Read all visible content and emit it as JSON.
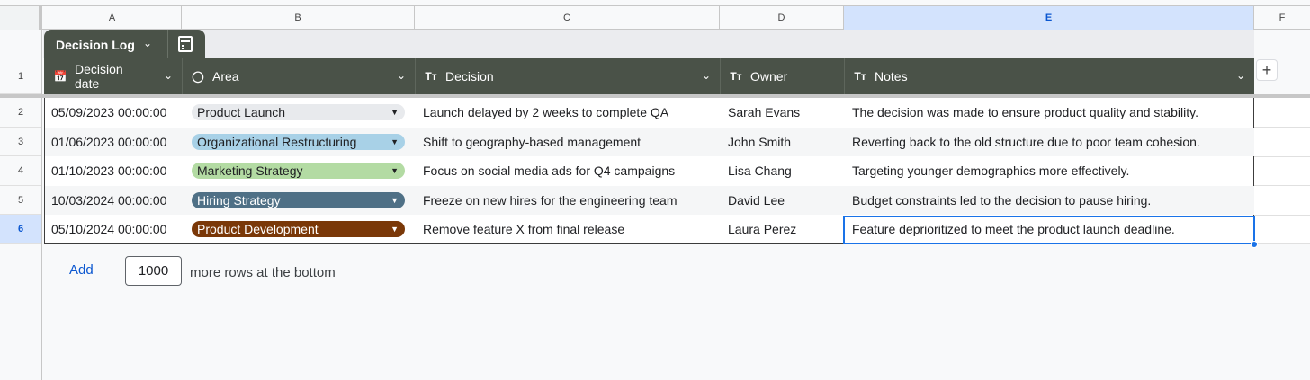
{
  "columns": [
    "A",
    "B",
    "C",
    "D",
    "E",
    "F"
  ],
  "selected_column": "E",
  "row_numbers": [
    "1",
    "2",
    "3",
    "4",
    "5",
    "6"
  ],
  "selected_row": "6",
  "table": {
    "name": "Decision Log",
    "headers": [
      {
        "label": "Decision date",
        "icon": "calendar-icon"
      },
      {
        "label": "Area",
        "icon": "dropdown-chip-icon"
      },
      {
        "label": "Decision",
        "icon": "text-type-icon",
        "icon_glyph": "Tт"
      },
      {
        "label": "Owner",
        "icon": "text-type-icon",
        "icon_glyph": "Tт"
      },
      {
        "label": "Notes",
        "icon": "text-type-icon",
        "icon_glyph": "Tт"
      }
    ],
    "rows": [
      {
        "date": "05/09/2023 00:00:00",
        "area": "Product Launch",
        "area_color": "#e8eaed",
        "area_text_color": "#202124",
        "decision": "Launch delayed by 2 weeks to complete QA",
        "owner": "Sarah Evans",
        "notes": "The decision was made to ensure product quality and stability."
      },
      {
        "date": "01/06/2023 00:00:00",
        "area": "Organizational Restructuring",
        "area_color": "#a8d1e7",
        "area_text_color": "#202124",
        "decision": "Shift to geography-based management",
        "owner": "John Smith",
        "notes": "Reverting back to the old structure due to poor team cohesion."
      },
      {
        "date": "01/10/2023 00:00:00",
        "area": "Marketing Strategy",
        "area_color": "#b3dba3",
        "area_text_color": "#202124",
        "decision": "Focus on social media ads for Q4 campaigns",
        "owner": "Lisa Chang",
        "notes": "Targeting younger demographics more effectively."
      },
      {
        "date": "10/03/2024 00:00:00",
        "area": "Hiring Strategy",
        "area_color": "#4f7086",
        "area_text_color": "#ffffff",
        "decision": "Freeze on new hires for the engineering team",
        "owner": "David Lee",
        "notes": "Budget constraints led to the decision to pause hiring."
      },
      {
        "date": "05/10/2024 00:00:00",
        "area": "Product Development",
        "area_color": "#7a3808",
        "area_text_color": "#ffffff",
        "decision": "Remove feature X from final release",
        "owner": "Laura Perez",
        "notes": "Feature deprioritized to meet the product launch deadline."
      }
    ]
  },
  "footer": {
    "add_label": "Add",
    "row_count": "1000",
    "suffix": "more rows at the bottom"
  },
  "colors": {
    "header_bg": "#4a5248",
    "selection": "#1a73e8"
  }
}
